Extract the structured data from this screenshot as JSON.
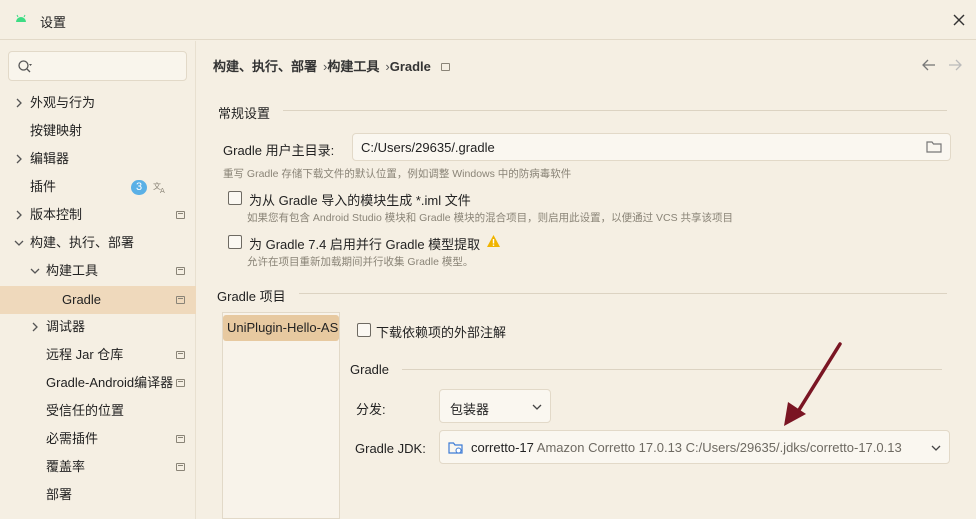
{
  "window": {
    "title": "设置"
  },
  "sidebar": {
    "search_placeholder": "",
    "items": [
      {
        "label": "外观与行为"
      },
      {
        "label": "按键映射"
      },
      {
        "label": "编辑器"
      },
      {
        "label": "插件",
        "badge": "3"
      },
      {
        "label": "版本控制"
      },
      {
        "label": "构建、执行、部署"
      },
      {
        "label": "构建工具"
      },
      {
        "label": "Gradle"
      },
      {
        "label": "调试器"
      },
      {
        "label": "远程 Jar 仓库"
      },
      {
        "label": "Gradle-Android编译器"
      },
      {
        "label": "受信任的位置"
      },
      {
        "label": "必需插件"
      },
      {
        "label": "覆盖率"
      },
      {
        "label": "部署"
      }
    ]
  },
  "breadcrumb": {
    "items": [
      "构建、执行、部署",
      "构建工具",
      "Gradle"
    ]
  },
  "general": {
    "title": "常规设置",
    "user_home_label": "Gradle 用户主目录:",
    "user_home_value": "C:/Users/29635/.gradle",
    "user_home_hint": "重写 Gradle 存储下载文件的默认位置，例如调整 Windows 中的防病毒软件",
    "iml_label": "为从 Gradle 导入的模块生成 *.iml 文件",
    "iml_hint": "如果您有包含 Android Studio 模块和 Gradle 模块的混合项目，则启用此设置，以便通过 VCS 共享该项目",
    "parallel_label": "为 Gradle 7.4 启用并行 Gradle 模型提取",
    "parallel_hint": "允许在项目重新加载期间并行收集 Gradle 模型。"
  },
  "projects": {
    "title": "Gradle 项目",
    "list": [
      "UniPlugin-Hello-AS"
    ],
    "download_annotations_label": "下载依赖项的外部注解",
    "gradle_section_title": "Gradle",
    "distribution_label": "分发:",
    "distribution_value": "包装器",
    "jdk_label": "Gradle JDK:",
    "jdk_name": "corretto-17",
    "jdk_detail": "Amazon Corretto 17.0.13 C:/Users/29635/.jdks/corretto-17.0.13"
  },
  "colors": {
    "selection": "#efd9bc",
    "project_selected": "#e7c9a0",
    "badge": "#5ab0e6",
    "warning": "#f0b400",
    "arrow": "#7a1523"
  }
}
